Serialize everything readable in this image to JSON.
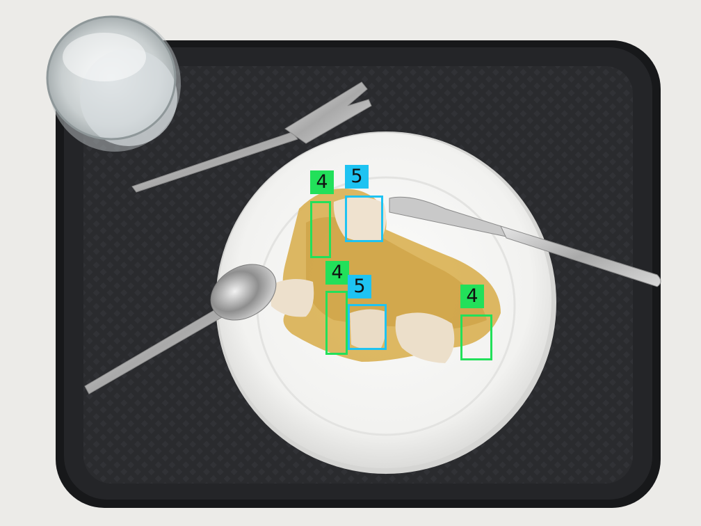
{
  "colors": {
    "class_4_box": "#22e05a",
    "class_5_box": "#1ec3f2"
  },
  "detections": [
    {
      "class_label": "4",
      "color_key": "class_4_box"
    },
    {
      "class_label": "5",
      "color_key": "class_5_box"
    },
    {
      "class_label": "4",
      "color_key": "class_4_box"
    },
    {
      "class_label": "5",
      "color_key": "class_5_box"
    },
    {
      "class_label": "4",
      "color_key": "class_4_box"
    }
  ]
}
